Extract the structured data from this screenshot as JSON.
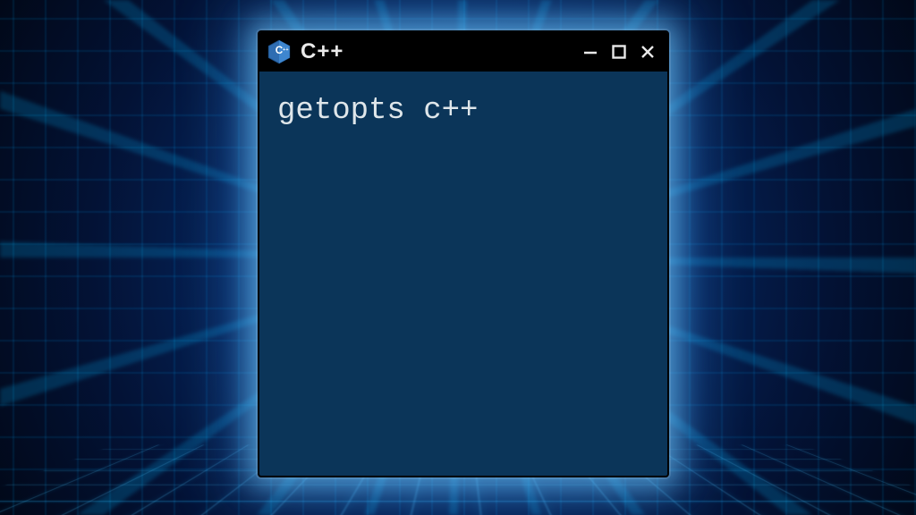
{
  "window": {
    "title": "C++",
    "content_text": "getopts c++",
    "logo_name": "cpp-logo"
  },
  "colors": {
    "window_bg": "#0b3559",
    "titlebar_bg": "#000000",
    "text": "#dfe6ea",
    "glow": "#4ec3ff"
  }
}
